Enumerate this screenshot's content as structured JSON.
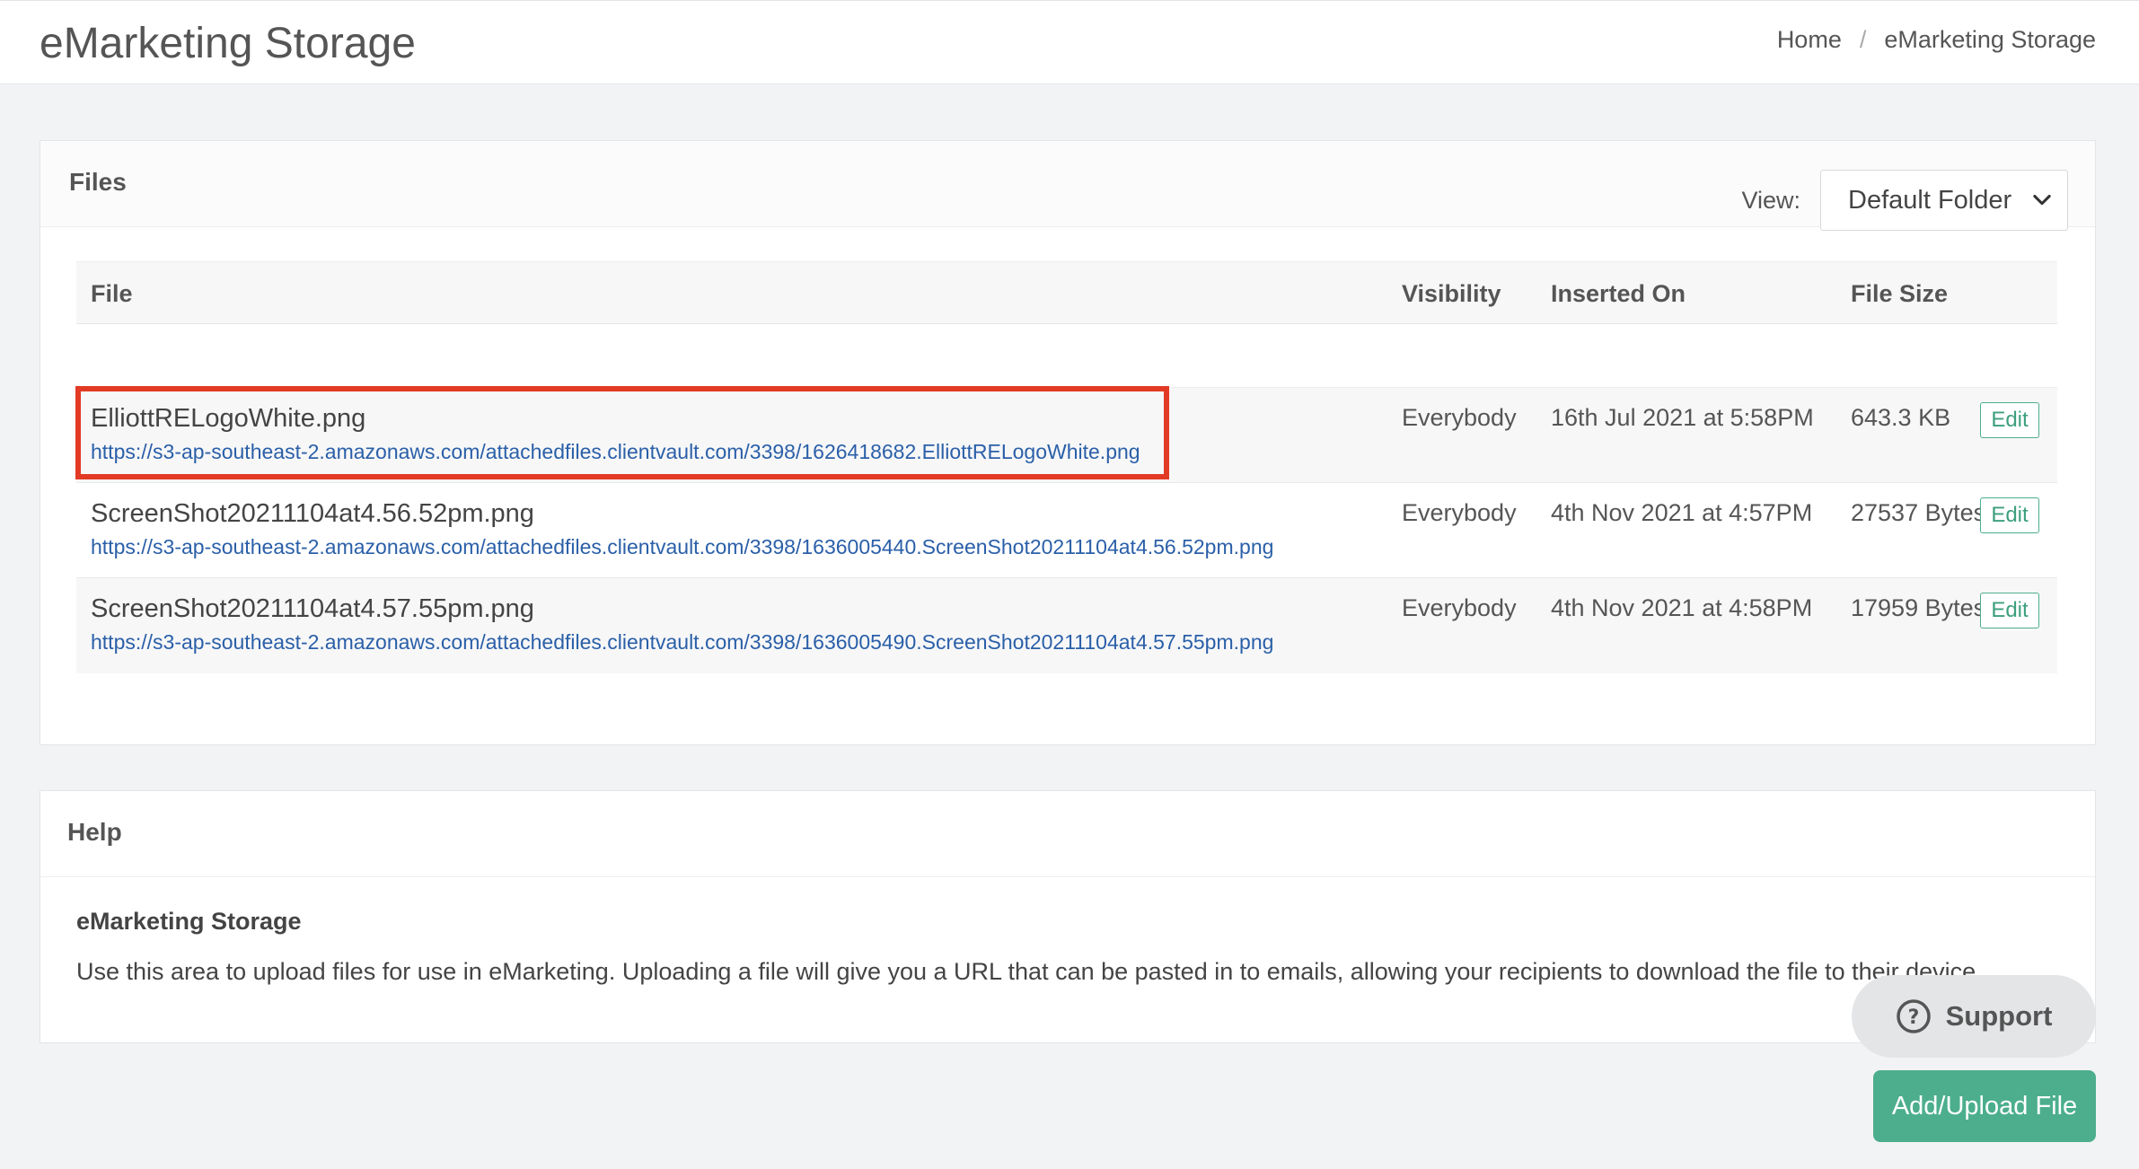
{
  "header": {
    "title": "eMarketing Storage",
    "breadcrumb": [
      "Home",
      "eMarketing Storage"
    ]
  },
  "files": {
    "heading": "Files",
    "view_label": "View:",
    "folder_select": "Default Folder",
    "columns": [
      "File",
      "Visibility",
      "Inserted On",
      "File Size"
    ],
    "rows": [
      {
        "name": "ElliottRELogoWhite.png",
        "url": "https://s3-ap-southeast-2.amazonaws.com/attachedfiles.clientvault.com/3398/1626418682.ElliottRELogoWhite.png",
        "visibility": "Everybody",
        "inserted": "16th Jul 2021 at 5:58PM",
        "size": "643.3 KB",
        "action": "Edit"
      },
      {
        "name": "ScreenShot20211104at4.56.52pm.png",
        "url": "https://s3-ap-southeast-2.amazonaws.com/attachedfiles.clientvault.com/3398/1636005440.ScreenShot20211104at4.56.52pm.png",
        "visibility": "Everybody",
        "inserted": "4th Nov 2021 at 4:57PM",
        "size": "27537 Bytes",
        "action": "Edit"
      },
      {
        "name": "ScreenShot20211104at4.57.55pm.png",
        "url": "https://s3-ap-southeast-2.amazonaws.com/attachedfiles.clientvault.com/3398/1636005490.ScreenShot20211104at4.57.55pm.png",
        "visibility": "Everybody",
        "inserted": "4th Nov 2021 at 4:58PM",
        "size": "17959 Bytes",
        "action": "Edit"
      }
    ]
  },
  "help": {
    "heading": "Help",
    "subtitle": "eMarketing Storage",
    "text": "Use this area to upload files for use in eMarketing. Uploading a file will give you a URL that can be pasted in to emails, allowing your recipients to download the file to their device."
  },
  "support_label": "Support",
  "upload_label": "Add/Upload File",
  "colors": {
    "accent": "#4cae8c",
    "link": "#2a5fa8",
    "highlight": "#e23a24"
  }
}
